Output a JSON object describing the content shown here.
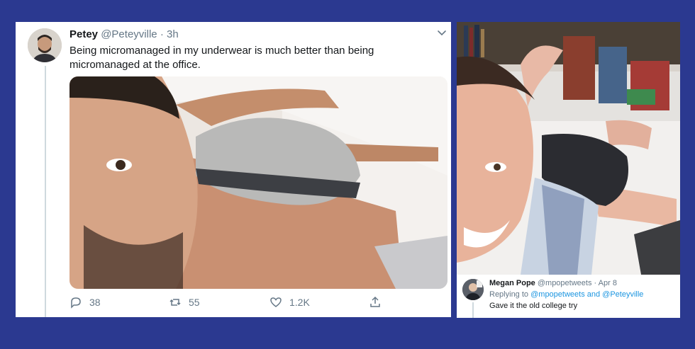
{
  "tweet": {
    "name": "Petey",
    "handle": "@Peteyville",
    "separator": "·",
    "time": "3h",
    "text": "Being micromanaged in my underwear is much better than being micromanaged at the office.",
    "actions": {
      "reply_count": "38",
      "retweet_count": "55",
      "like_count": "1.2K"
    }
  },
  "reply_tweet": {
    "name": "Megan Pope",
    "handle": "@mpopetweets",
    "separator": "·",
    "date": "Apr 8",
    "replying_prefix": "Replying to",
    "replying_to": "@mpopetweets and @Peteyville",
    "text": "Gave it the old college try"
  },
  "icons": {
    "reply": "reply-icon",
    "retweet": "retweet-icon",
    "like": "heart-icon",
    "share": "share-icon",
    "more": "chevron-down-icon"
  },
  "colors": {
    "background": "#2b3990",
    "muted": "#657786",
    "link": "#1b95e0"
  }
}
